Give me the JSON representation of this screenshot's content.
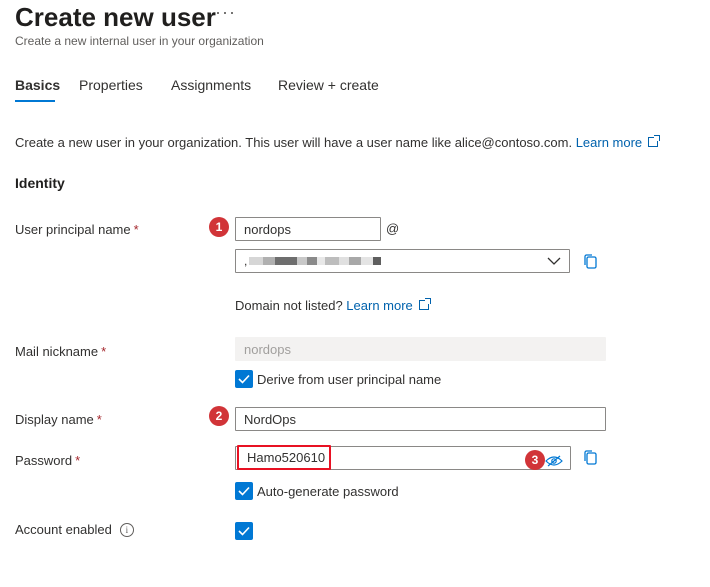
{
  "page": {
    "title": "Create new user",
    "more": "···",
    "subtitle": "Create a new internal user in your organization"
  },
  "tabs": [
    {
      "label": "Basics",
      "active": true
    },
    {
      "label": "Properties"
    },
    {
      "label": "Assignments"
    },
    {
      "label": "Review + create"
    }
  ],
  "intro": {
    "text": "Create a new user in your organization. This user will have a user name like alice@contoso.com.",
    "link": "Learn more"
  },
  "identity": {
    "heading": "Identity",
    "upn": {
      "label": "User principal name",
      "required": "*",
      "value": "nordops",
      "at": "@",
      "badge": "1",
      "domain_prefix": ","
    },
    "domain_hint": {
      "text": "Domain not listed?",
      "link": "Learn more"
    },
    "mail_nickname": {
      "label": "Mail nickname",
      "required": "*",
      "value": "nordops",
      "derive_label": "Derive from user principal name"
    },
    "display_name": {
      "label": "Display name",
      "required": "*",
      "value": "NordOps",
      "badge": "2"
    },
    "password": {
      "label": "Password",
      "required": "*",
      "value": "Hamo520610",
      "badge": "3",
      "auto_label": "Auto-generate password"
    },
    "account_enabled": {
      "label": "Account enabled",
      "info": "i"
    }
  },
  "colors": {
    "accent": "#0078d4",
    "badge": "#d13438",
    "highlight": "#e81123",
    "link": "#0062ad"
  },
  "icons": {
    "copy": "copy-icon",
    "eye": "eye-icon",
    "chevron": "chevron-down-icon",
    "external": "external-link-icon"
  }
}
